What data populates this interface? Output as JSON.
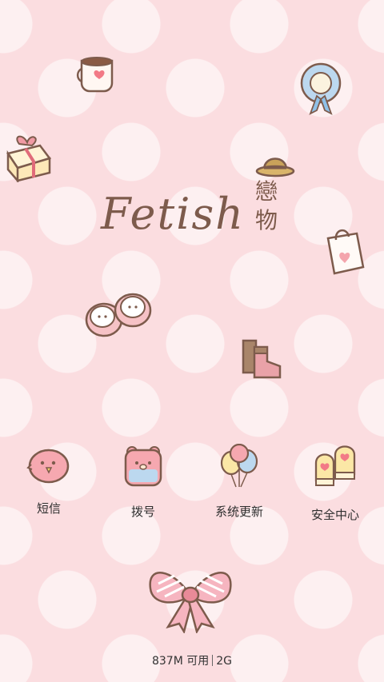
{
  "widget": {
    "title_en": "Fetish",
    "title_cn_1": "戀",
    "title_cn_2": "物"
  },
  "apps": [
    {
      "label": "短信",
      "icon": "chick-message-icon"
    },
    {
      "label": "拨号",
      "icon": "bear-dialer-icon"
    },
    {
      "label": "系统更新",
      "icon": "balloons-update-icon"
    },
    {
      "label": "安全中心",
      "icon": "mittens-security-icon"
    }
  ],
  "memory": {
    "free": "837M 可用",
    "total": "2G"
  },
  "colors": {
    "background": "#fbdde0",
    "text_dark": "#2e2e2e",
    "brown": "#7d5b4c"
  }
}
